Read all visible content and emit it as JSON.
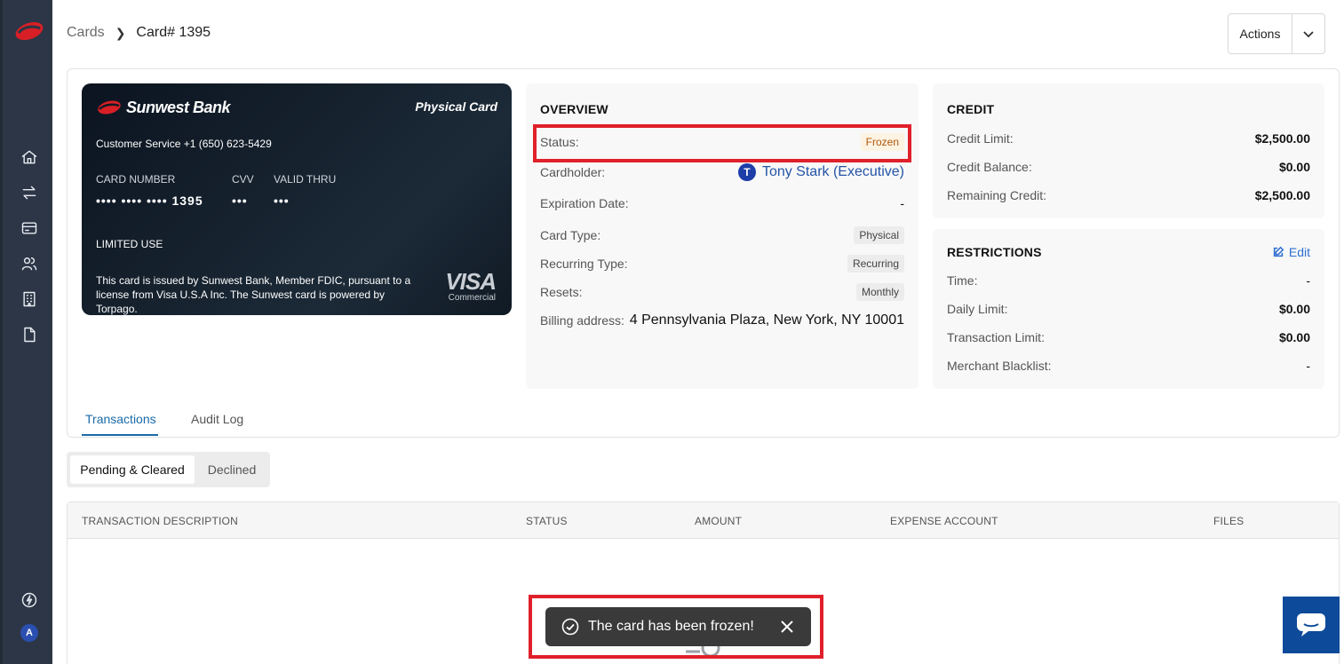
{
  "breadcrumb": {
    "parent": "Cards",
    "current": "Card# 1395"
  },
  "actions": {
    "label": "Actions"
  },
  "card": {
    "bank_name": "Sunwest Bank",
    "card_kind": "Physical Card",
    "customer_service": "Customer Service +1 (650) 623-5429",
    "number_label": "CARD NUMBER",
    "number_value": "•••• •••• •••• 1395",
    "cvv_label": "CVV",
    "cvv_value": "•••",
    "valid_label": "VALID THRU",
    "valid_value": "•••",
    "usage": "LIMITED USE",
    "legal": "This card is issued by Sunwest Bank, Member FDIC, pursuant to a license from Visa U.S.A Inc. The Sunwest card is powered by Torpago.",
    "network": "VISA",
    "network_sub": "Commercial"
  },
  "overview": {
    "title": "OVERVIEW",
    "status_label": "Status:",
    "status_value": "Frozen",
    "cardholder_label": "Cardholder:",
    "cardholder_initial": "T",
    "cardholder_value": "Tony Stark (Executive)",
    "expiration_label": "Expiration Date:",
    "expiration_value": "-",
    "card_type_label": "Card Type:",
    "card_type_value": "Physical",
    "recurring_label": "Recurring Type:",
    "recurring_value": "Recurring",
    "resets_label": "Resets:",
    "resets_value": "Monthly",
    "billing_label": "Billing address:",
    "billing_value": "4 Pennsylvania Plaza, New York, NY 10001"
  },
  "credit": {
    "title": "CREDIT",
    "limit_label": "Credit Limit:",
    "limit_value": "$2,500.00",
    "balance_label": "Credit Balance:",
    "balance_value": "$0.00",
    "remaining_label": "Remaining Credit:",
    "remaining_value": "$2,500.00"
  },
  "restrictions": {
    "title": "RESTRICTIONS",
    "edit_label": "Edit",
    "time_label": "Time:",
    "time_value": "-",
    "daily_label": "Daily Limit:",
    "daily_value": "$0.00",
    "txn_label": "Transaction Limit:",
    "txn_value": "$0.00",
    "merchant_label": "Merchant Blacklist:",
    "merchant_value": "-"
  },
  "tabs": {
    "transactions": "Transactions",
    "audit": "Audit Log"
  },
  "segment": {
    "pending": "Pending & Cleared",
    "declined": "Declined"
  },
  "table": {
    "columns": [
      "TRANSACTION DESCRIPTION",
      "STATUS",
      "AMOUNT",
      "EXPENSE ACCOUNT",
      "FILES"
    ]
  },
  "toast": {
    "message": "The card has been frozen!"
  },
  "user": {
    "initial": "A"
  },
  "colors": {
    "sidebar": "#2c3646",
    "accent": "#1a6aa8",
    "frozen": "#b0560a",
    "highlight": "#e0202a",
    "brand_red": "#d81f26"
  }
}
